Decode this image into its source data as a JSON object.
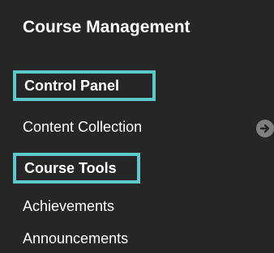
{
  "menu": {
    "heading": "Course Management",
    "control_panel_label": "Control Panel",
    "content_collection_label": "Content Collection",
    "course_tools_label": "Course Tools",
    "achievements_label": "Achievements",
    "announcements_label": "Announcements",
    "expand_icon": "arrow-right-circle-icon",
    "highlight_color": "#5cc8cc",
    "background_color": "#262626"
  }
}
